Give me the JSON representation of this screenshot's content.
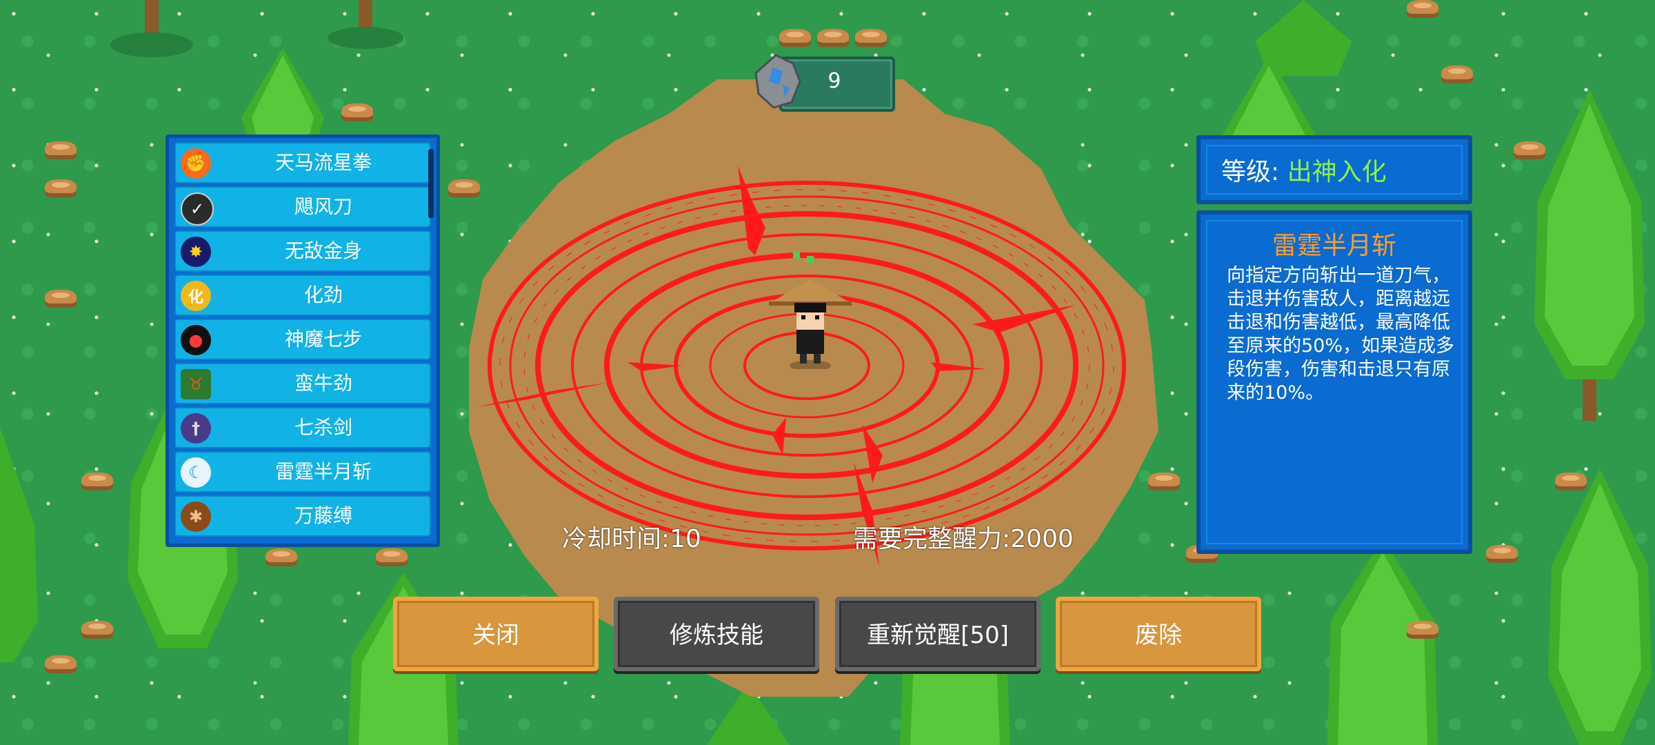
{
  "currency": {
    "value": "9"
  },
  "skills": [
    {
      "label": "天马流星拳",
      "icon": "fist-icon",
      "color": "#ff6a1a"
    },
    {
      "label": "飓风刀",
      "icon": "blade-icon",
      "color": "#2b2b2b"
    },
    {
      "label": "无敌金身",
      "icon": "golden-body-icon",
      "color": "#1a1a6a"
    },
    {
      "label": "化劲",
      "icon": "hua-icon",
      "color": "#f2b81a"
    },
    {
      "label": "神魔七步",
      "icon": "demon-mask-icon",
      "color": "#111111"
    },
    {
      "label": "蛮牛劲",
      "icon": "bull-icon",
      "color": "#2e7a2e"
    },
    {
      "label": "七杀剑",
      "icon": "sword-icon",
      "color": "#4a3a8a"
    },
    {
      "label": "雷霆半月斩",
      "icon": "crescent-slash-icon",
      "color": "#1a8ae6"
    },
    {
      "label": "万藤缚",
      "icon": "vine-bind-icon",
      "color": "#8a4a1a"
    }
  ],
  "level": {
    "label": "等级: ",
    "value": "出神入化"
  },
  "detail": {
    "title": "雷霆半月斩",
    "description": "向指定方向斩出一道刀气，击退并伤害敌人，距离越远击退和伤害越低，最高降低至原来的50%，如果造成多段伤害，伤害和击退只有原来的10%。"
  },
  "cooldown": "冷却时间:10",
  "requirement": "需要完整醒力:2000",
  "buttons": {
    "close": "关闭",
    "train": "修炼技能",
    "reawaken": "重新觉醒[50]",
    "remove": "废除"
  },
  "colors": {
    "accent_level": "#8ef04a",
    "title_orange": "#ff9d2e",
    "magic_circle": "#ff1a1a"
  }
}
